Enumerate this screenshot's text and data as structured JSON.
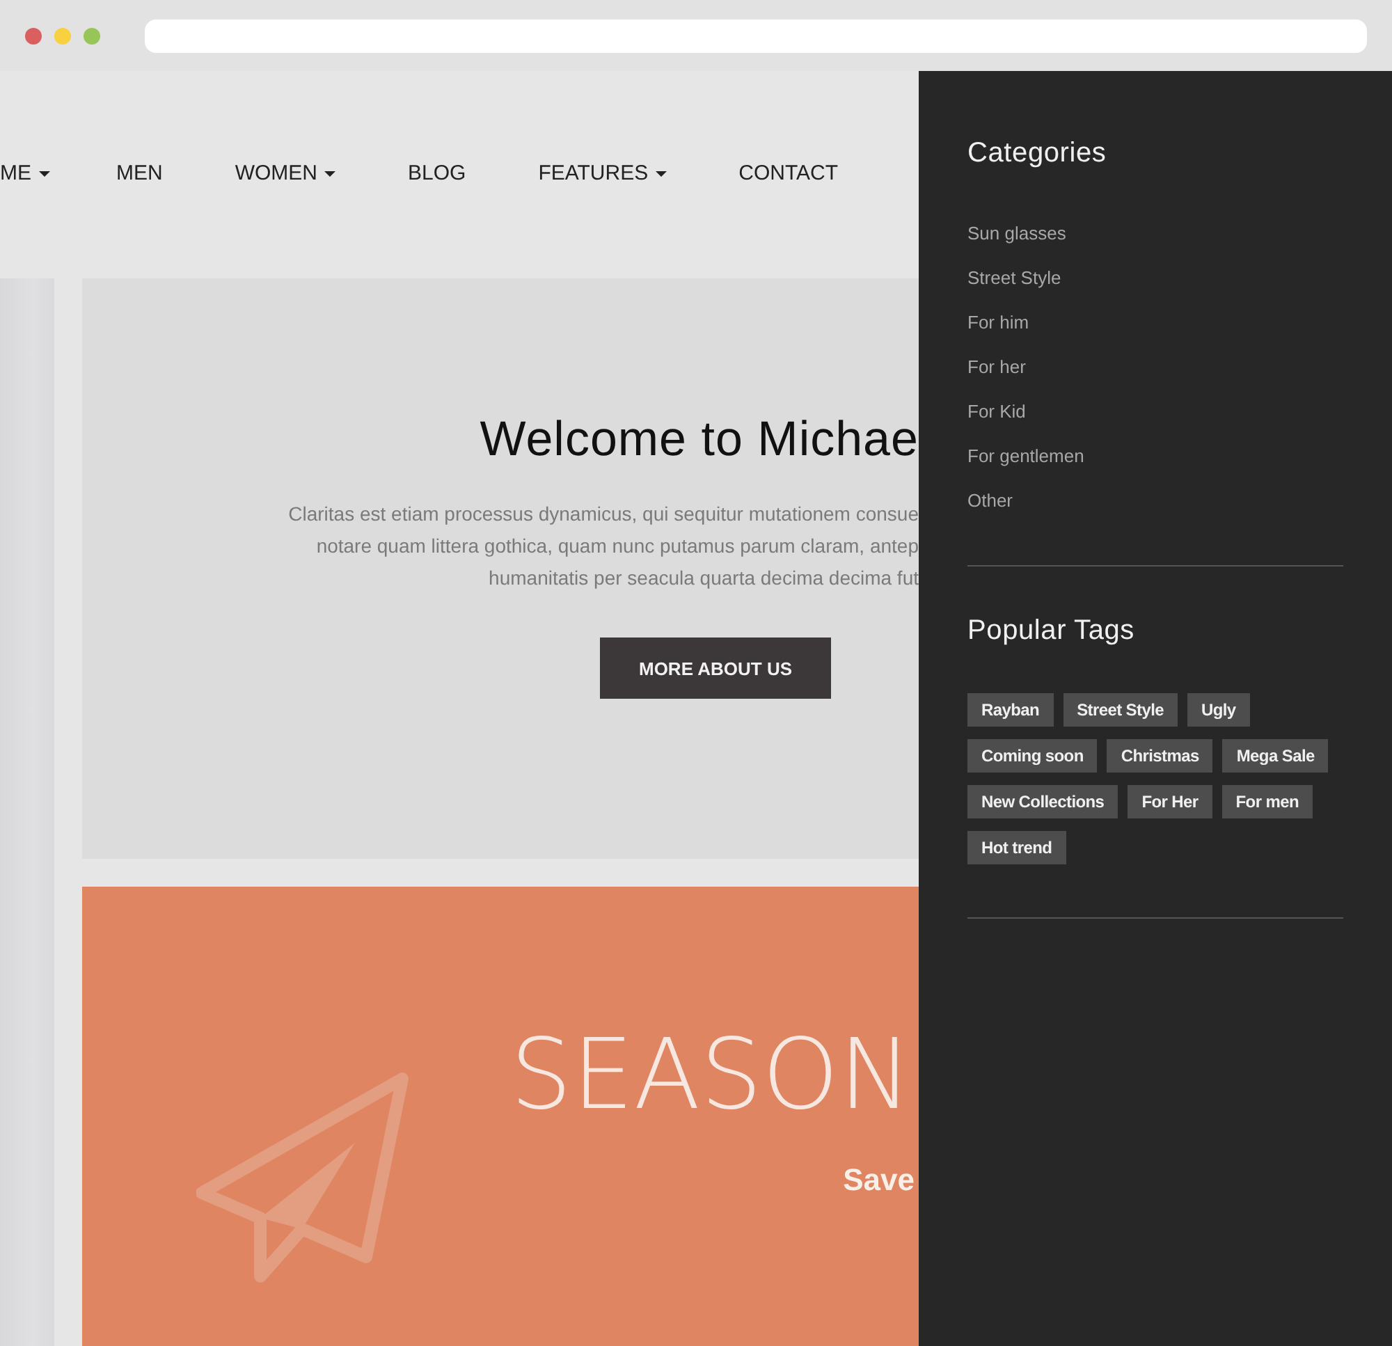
{
  "nav": {
    "items": [
      {
        "label": "ME",
        "dropdown": true
      },
      {
        "label": "MEN",
        "dropdown": false
      },
      {
        "label": "WOMEN",
        "dropdown": true
      },
      {
        "label": "BLOG",
        "dropdown": false
      },
      {
        "label": "FEATURES",
        "dropdown": true
      },
      {
        "label": "CONTACT",
        "dropdown": false
      }
    ]
  },
  "hero": {
    "title": "Welcome to Michae",
    "lines": [
      "Claritas est etiam processus dynamicus, qui sequitur mutationem consue",
      "notare quam littera gothica, quam nunc putamus parum claram, antep",
      "humanitatis per seacula quarta decima decima fut"
    ],
    "button": "MORE ABOUT US"
  },
  "promo": {
    "title": "SEASON",
    "subtitle": "Save"
  },
  "sidebar": {
    "categories": {
      "title": "Categories",
      "items": [
        "Sun glasses",
        "Street Style",
        "For him",
        "For her",
        "For Kid",
        "For gentlemen",
        "Other"
      ]
    },
    "tags": {
      "title": "Popular Tags",
      "items": [
        "Rayban",
        "Street Style",
        "Ugly",
        "Coming soon",
        "Christmas",
        "Mega Sale",
        "New Collections",
        "For Her",
        "For men",
        "Hot trend"
      ]
    }
  }
}
